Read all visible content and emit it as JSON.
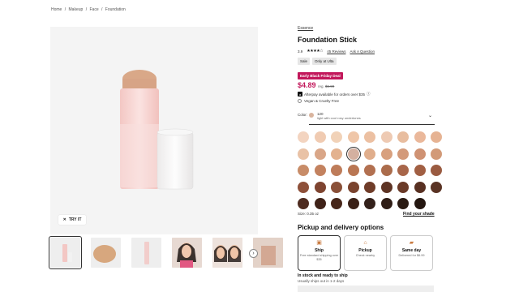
{
  "breadcrumb": [
    "Home",
    "/",
    "Makeup",
    "/",
    "Face",
    "/",
    "Foundation"
  ],
  "gallery": {
    "try_it": "TRY IT"
  },
  "product": {
    "brand": "Essence",
    "title": "Foundation Stick",
    "rating_value": "3.9",
    "stars": "★★★★☆",
    "reviews": "45 Reviews",
    "ask": "Ask A Question",
    "badges": [
      "Sale",
      "Only at Ulta"
    ],
    "deal": "Early Black Friday Deal",
    "price": "$4.89",
    "reg_label": "reg.",
    "reg_price": "$6.99",
    "afterpay": "Afterpay available for orders over $35",
    "cruelty_free": "Vegan & Cruelty Free",
    "color_label": "Color:",
    "shade_name": "120",
    "shade_desc": "light with cool rosy undertones",
    "size": "Size: 0.35 oz",
    "find_shade": "Find your shade"
  },
  "swatches": [
    "#f3d4c0",
    "#f0cbb2",
    "#f1d2b8",
    "#efc6a8",
    "#ecc0a2",
    "#eecab3",
    "#e8bd9f",
    "#eab89b",
    "#e6b393",
    "#e9c2a6",
    "#d9a688",
    "#e3b28f",
    "#d4b0a0",
    "#e0ae8c",
    "#d8a07e",
    "#d39a7a",
    "#cf9273",
    "#d29a78",
    "#c88c68",
    "#c3825f",
    "#be7c5a",
    "#b97653",
    "#b27050",
    "#ab6c4c",
    "#a8664a",
    "#a15f43",
    "#9a5b41",
    "#8e5039",
    "#7e4430",
    "#8a5038",
    "#7a432e",
    "#6f3c29",
    "#5e3424",
    "#6a3a28",
    "#583022",
    "#5a3324",
    "#4e2b1f",
    "#3f2218",
    "#472619",
    "#3a2016",
    "#33201a",
    "#2f1d15",
    "#2a1a12",
    "#241610"
  ],
  "selected_swatch": 12,
  "pickup": {
    "title": "Pickup and delivery options",
    "options": [
      {
        "icon": "box-icon",
        "glyph": "▣",
        "label": "Ship",
        "sub": "Free standard shipping over $35"
      },
      {
        "icon": "store-icon",
        "glyph": "⌂",
        "label": "Pickup",
        "sub": "Check nearby"
      },
      {
        "icon": "truck-icon",
        "glyph": "▰",
        "label": "Same day",
        "sub": "Delivered for $6.99"
      }
    ],
    "stock": "In stock and ready to ship",
    "stock_sub": "Usually ships out in 1-2 days"
  },
  "colors": {
    "accent": "#c2185b"
  }
}
